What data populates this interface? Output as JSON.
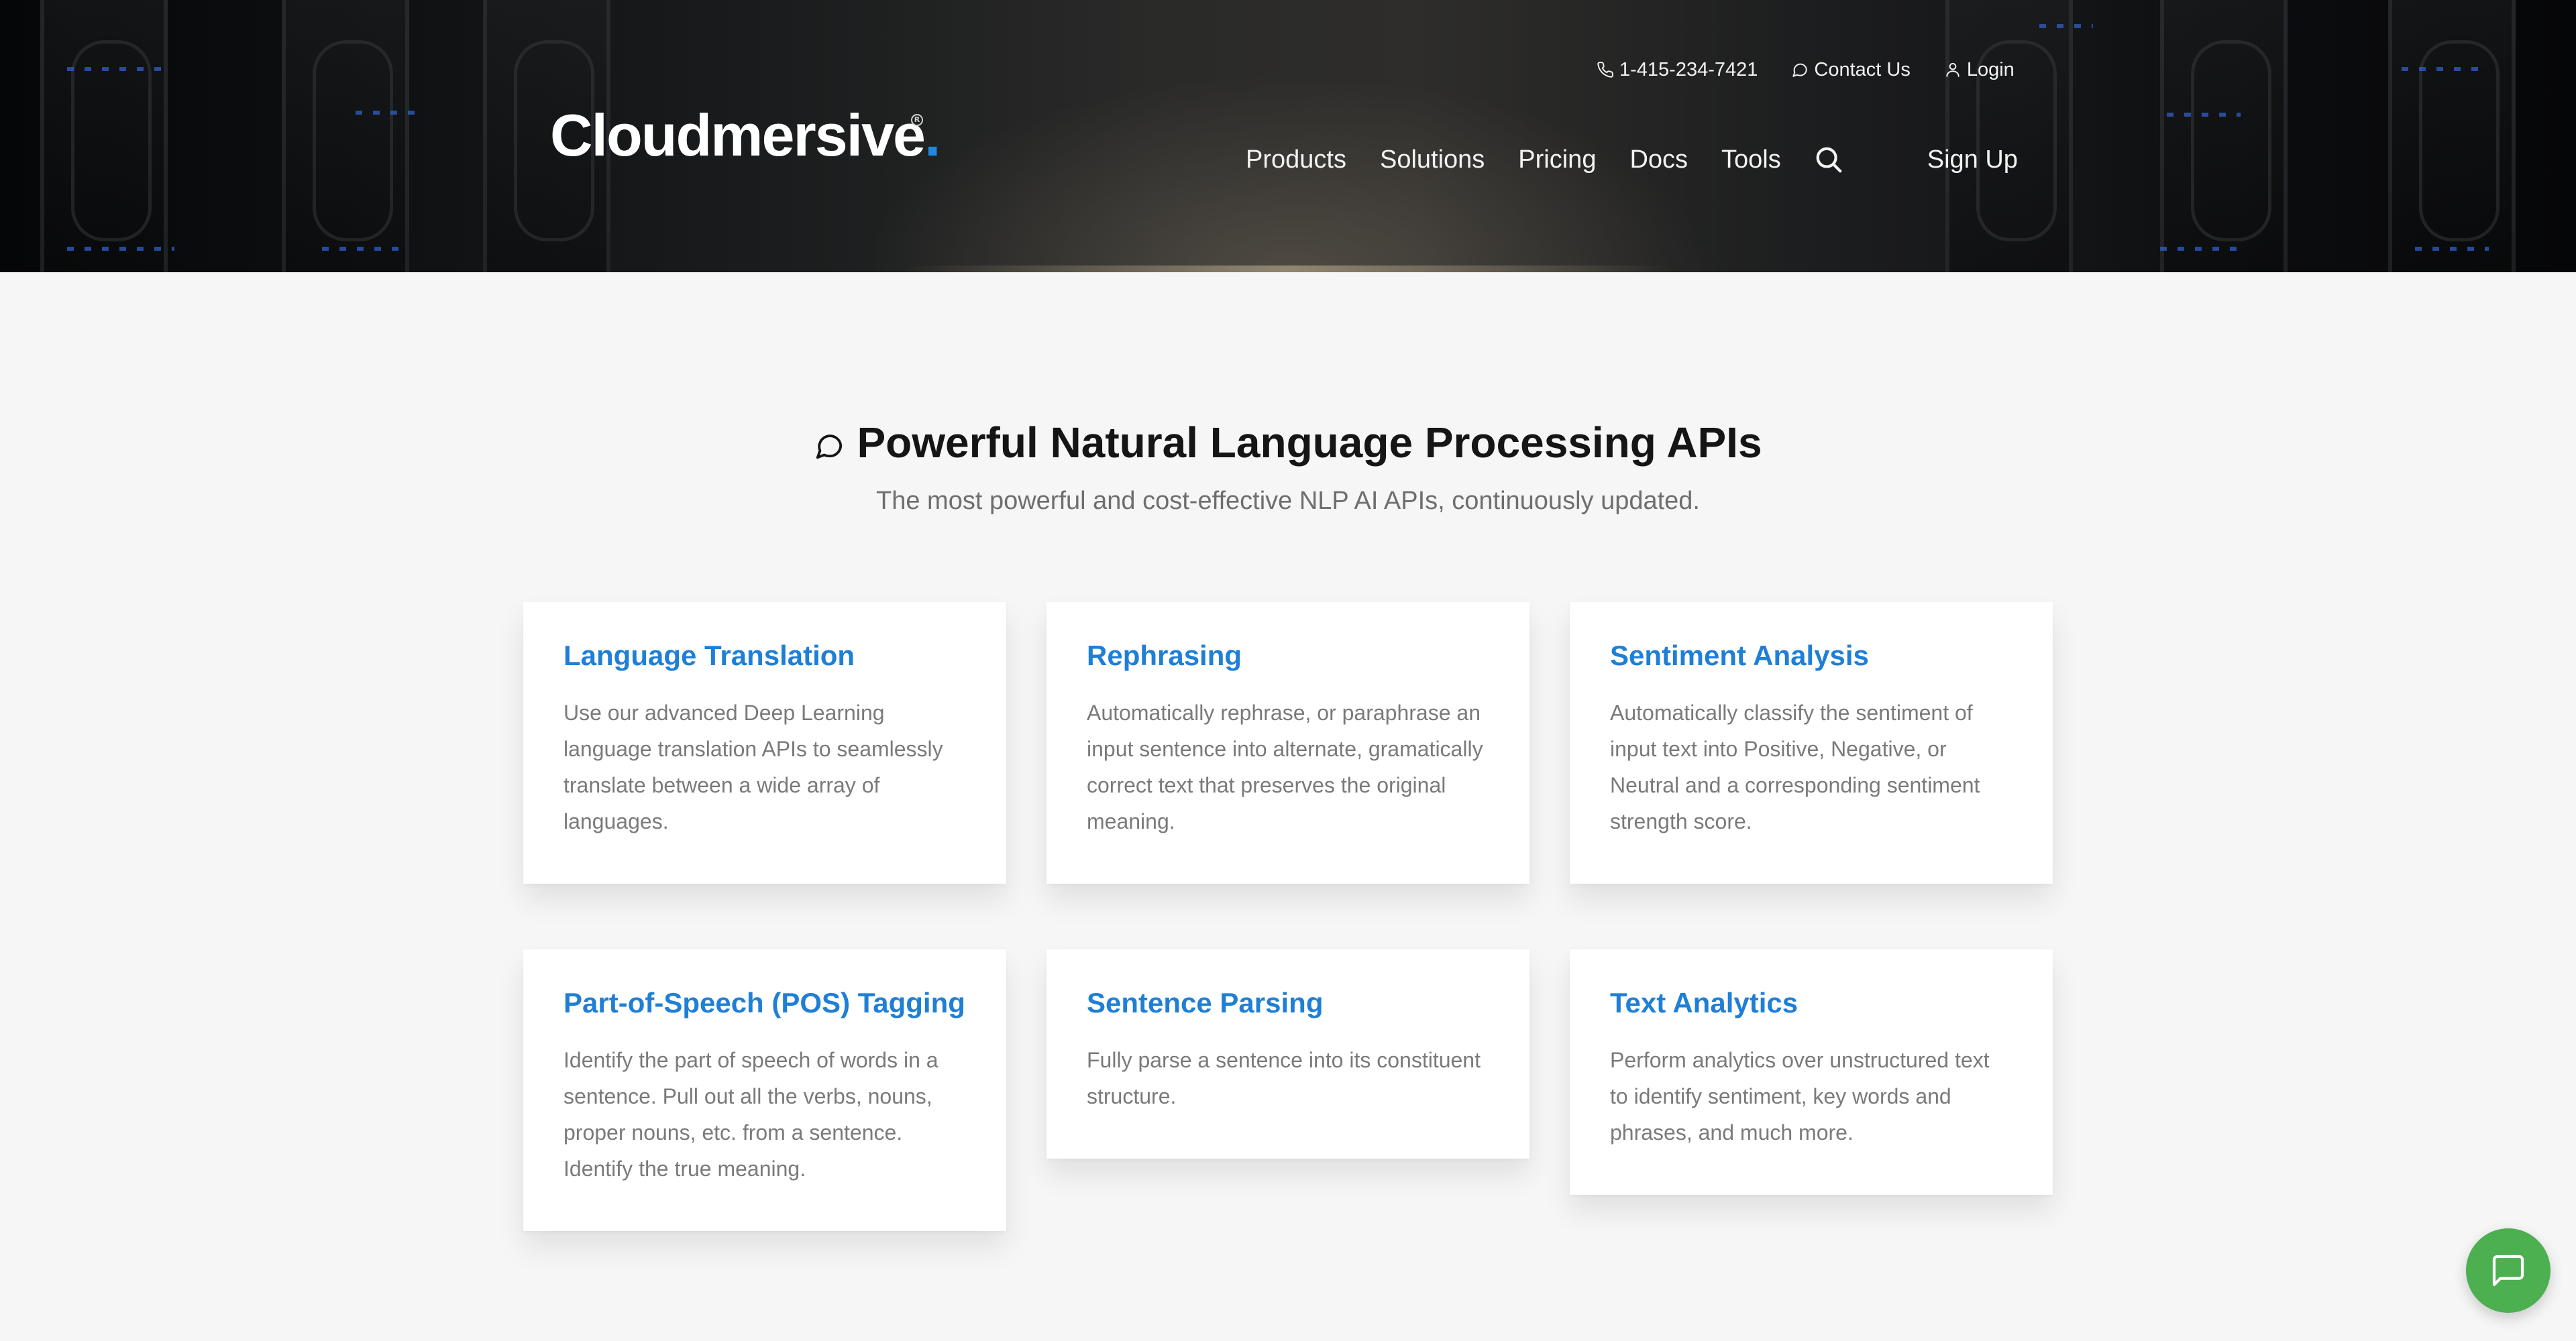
{
  "header": {
    "logo_text": "Cloudmersive",
    "logo_dot": ".",
    "logo_registered": "R",
    "top_links": {
      "phone": "1-415-234-7421",
      "contact": "Contact Us",
      "login": "Login"
    },
    "nav": {
      "products": "Products",
      "solutions": "Solutions",
      "pricing": "Pricing",
      "docs": "Docs",
      "tools": "Tools",
      "signup": "Sign Up"
    },
    "icons": {
      "phone": "phone-icon",
      "contact": "chat-bubble-icon",
      "login": "user-icon",
      "search": "search-icon"
    }
  },
  "section": {
    "title": "Powerful Natural Language Processing APIs",
    "subtitle": "The most powerful and cost-effective NLP AI APIs, continuously updated.",
    "title_icon": "chat-bubble-icon"
  },
  "cards": [
    {
      "title": "Language Translation",
      "description": "Use our advanced Deep Learning language translation APIs to seamlessly translate between a wide array of languages."
    },
    {
      "title": "Rephrasing",
      "description": "Automatically rephrase, or paraphrase an input sentence into alternate, gramatically correct text that preserves the original meaning."
    },
    {
      "title": "Sentiment Analysis",
      "description": "Automatically classify the sentiment of input text into Positive, Negative, or Neutral and a corresponding sentiment strength score."
    },
    {
      "title": "Part-of-Speech (POS) Tagging",
      "description": "Identify the part of speech of words in a sentence. Pull out all the verbs, nouns, proper nouns, etc. from a sentence. Identify the true meaning."
    },
    {
      "title": "Sentence Parsing",
      "description": "Fully parse a sentence into its constituent structure."
    },
    {
      "title": "Text Analytics",
      "description": "Perform analytics over unstructured text to identify sentiment, key words and phrases, and much more."
    }
  ],
  "chat_widget": {
    "icon": "chat-icon"
  },
  "colors": {
    "accent": "#1f7fd6",
    "logo_dot": "#1e88e5",
    "chat_button": "#4caf50",
    "page_background": "#f6f6f6"
  }
}
